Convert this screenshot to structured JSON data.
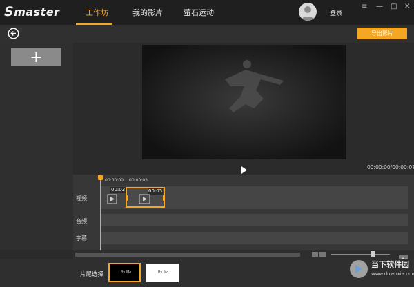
{
  "app": {
    "logo_text": "master",
    "logo_initial": "S"
  },
  "nav": {
    "tabs": [
      {
        "label": "工作坊",
        "active": true
      },
      {
        "label": "我的影片",
        "active": false
      },
      {
        "label": "萤石运动",
        "active": false
      }
    ],
    "login_label": "登录",
    "window_controls": [
      "≡",
      "—",
      "□",
      "✕"
    ]
  },
  "toolbar": {
    "export_label": "导出影片"
  },
  "media": {
    "add_icon": "plus-icon"
  },
  "player": {
    "timecode": "00:00:00/00:00:07",
    "play_icon": "play-icon"
  },
  "timeline": {
    "ticks": [
      "00:00:00",
      "00:00:03"
    ],
    "tracks": {
      "video": "视频",
      "audio": "音频",
      "subtitle": "字幕"
    },
    "clips": [
      {
        "duration": "00:03",
        "selected": false
      },
      {
        "duration": "00:05",
        "selected": true
      }
    ],
    "zoom_level": 0.68
  },
  "tail": {
    "label": "片尾选择",
    "options": [
      {
        "style": "dark",
        "text": "By Mo",
        "selected": true
      },
      {
        "style": "light",
        "text": "By Mo",
        "selected": false
      }
    ]
  },
  "watermark": {
    "title": "当下软件园",
    "url": "www.downxia.com"
  },
  "colors": {
    "accent": "#f5a623",
    "header_bg": "#1f1f1f",
    "panel_bg": "#2f2f2f",
    "track_bg": "#454545"
  }
}
